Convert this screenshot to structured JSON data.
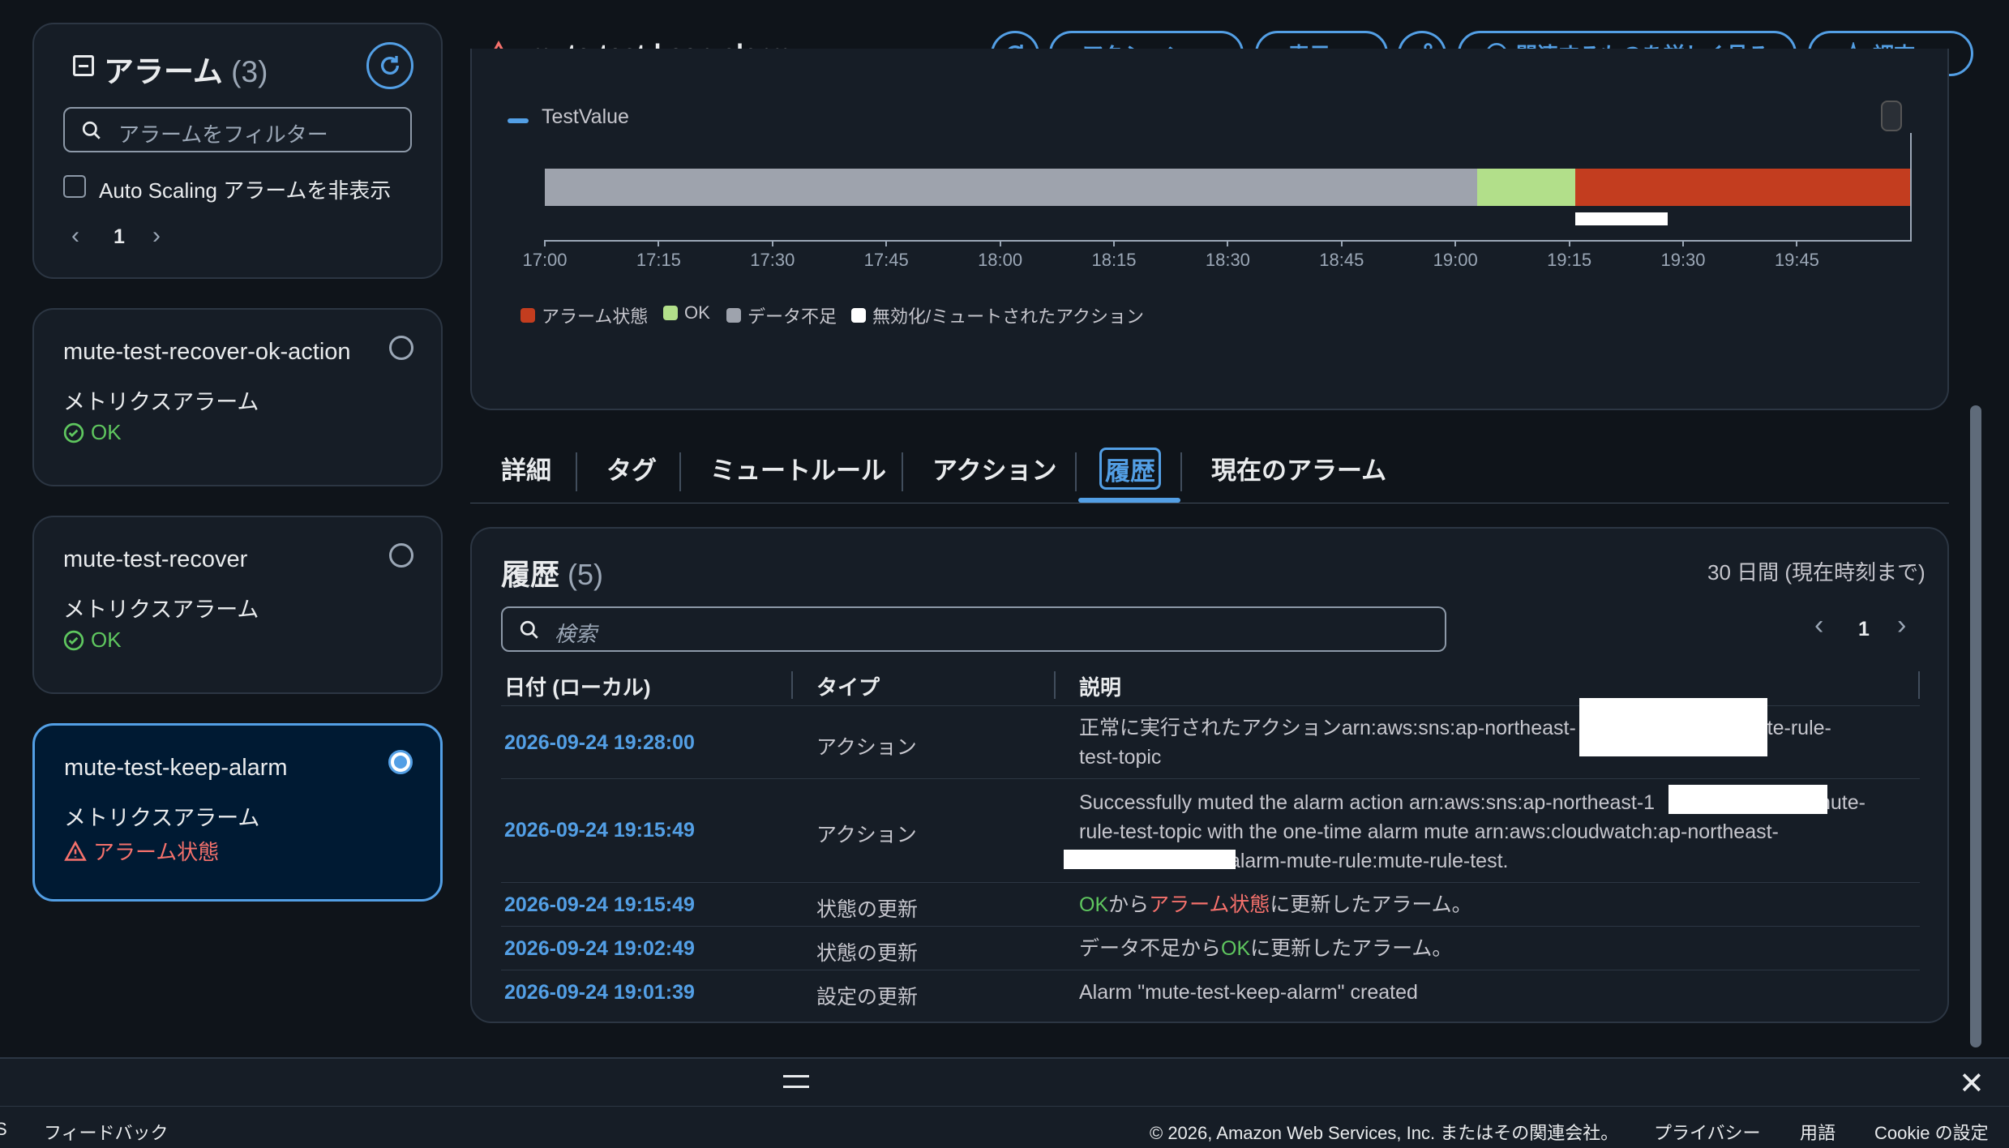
{
  "sidebar": {
    "title": "アラーム",
    "count": "(3)",
    "filter_placeholder": "アラームをフィルター",
    "autoscaling_label": "Auto Scaling アラームを非表示",
    "page": "1",
    "items": [
      {
        "name": "mute-test-recover-ok-action",
        "type": "メトリクスアラーム",
        "status": "OK"
      },
      {
        "name": "mute-test-recover",
        "type": "メトリクスアラーム",
        "status": "OK"
      },
      {
        "name": "mute-test-keep-alarm",
        "type": "メトリクスアラーム",
        "status": "アラーム状態"
      }
    ]
  },
  "header": {
    "title": "mute-test-keep-alarm",
    "actions_label": "アクション",
    "view_label": "表示",
    "explore_label": "関連するものを詳しく見る",
    "investigate_label": "調査"
  },
  "timeline": {
    "series_name": "TestValue",
    "x_labels": [
      "17:00",
      "17:15",
      "17:30",
      "17:45",
      "18:00",
      "18:15",
      "18:30",
      "18:45",
      "19:00",
      "19:15",
      "19:30",
      "19:45"
    ],
    "segments": [
      {
        "state": "insufficient",
        "start": "17:00",
        "end": "19:02:49",
        "color": "#9ea3ad"
      },
      {
        "state": "ok",
        "start": "19:02:49",
        "end": "19:15:49",
        "color": "#b2df8a"
      },
      {
        "state": "alarm",
        "start": "19:15:49",
        "end": "20:00",
        "color": "#c33d1f"
      }
    ],
    "muted": {
      "start": "19:15:49",
      "end": "19:28:00",
      "color": "#ffffff"
    },
    "legend": [
      {
        "label": "アラーム状態",
        "color": "#c33d1f"
      },
      {
        "label": "OK",
        "color": "#b2df8a"
      },
      {
        "label": "データ不足",
        "color": "#9ea3ad"
      },
      {
        "label": "無効化/ミュートされたアクション",
        "color": "#ffffff"
      }
    ]
  },
  "tabs": [
    "詳細",
    "タグ",
    "ミュートルール",
    "アクション",
    "履歴",
    "現在のアラーム"
  ],
  "history": {
    "title": "履歴",
    "count": "(5)",
    "range": "30 日間 (現在時刻まで)",
    "search_placeholder": "検索",
    "page": "1",
    "columns": [
      "日付 (ローカル)",
      "タイプ",
      "説明"
    ],
    "rows": [
      {
        "date": "2026-09-24 19:28:00",
        "type": "アクション",
        "desc_a": "正常に実行されたアクションarn:aws:sns:ap-northeast-",
        "desc_b": "ute-rule-",
        "desc_c": "test-topic"
      },
      {
        "date": "2026-09-24 19:15:49",
        "type": "アクション",
        "desc_a": "Successfully muted the alarm action arn:aws:sns:ap-northeast-1",
        "desc_b": "mute-",
        "desc_c": "rule-test-topic with the one-time alarm mute arn:aws:cloudwatch:ap-northeast-",
        "desc_d": ":alarm-mute-rule:mute-rule-test."
      },
      {
        "date": "2026-09-24 19:15:49",
        "type": "状態の更新",
        "ok": "OK",
        "from": "から",
        "alarm": "アラーム状態",
        "suffix": "に更新したアラーム。"
      },
      {
        "date": "2026-09-24 19:02:49",
        "type": "状態の更新",
        "insufficient": "データ不足から",
        "ok": "OK",
        "suffix": "に更新したアラーム。"
      },
      {
        "date": "2026-09-24 19:01:39",
        "type": "設定の更新",
        "desc": "Alarm \"mute-test-keep-alarm\" created"
      }
    ]
  },
  "footer": {
    "left_char": "S",
    "feedback": "フィードバック",
    "copyright": "© 2026, Amazon Web Services, Inc. またはその関連会社。",
    "privacy": "プライバシー",
    "terms": "用語",
    "cookie": "Cookie の設定"
  }
}
